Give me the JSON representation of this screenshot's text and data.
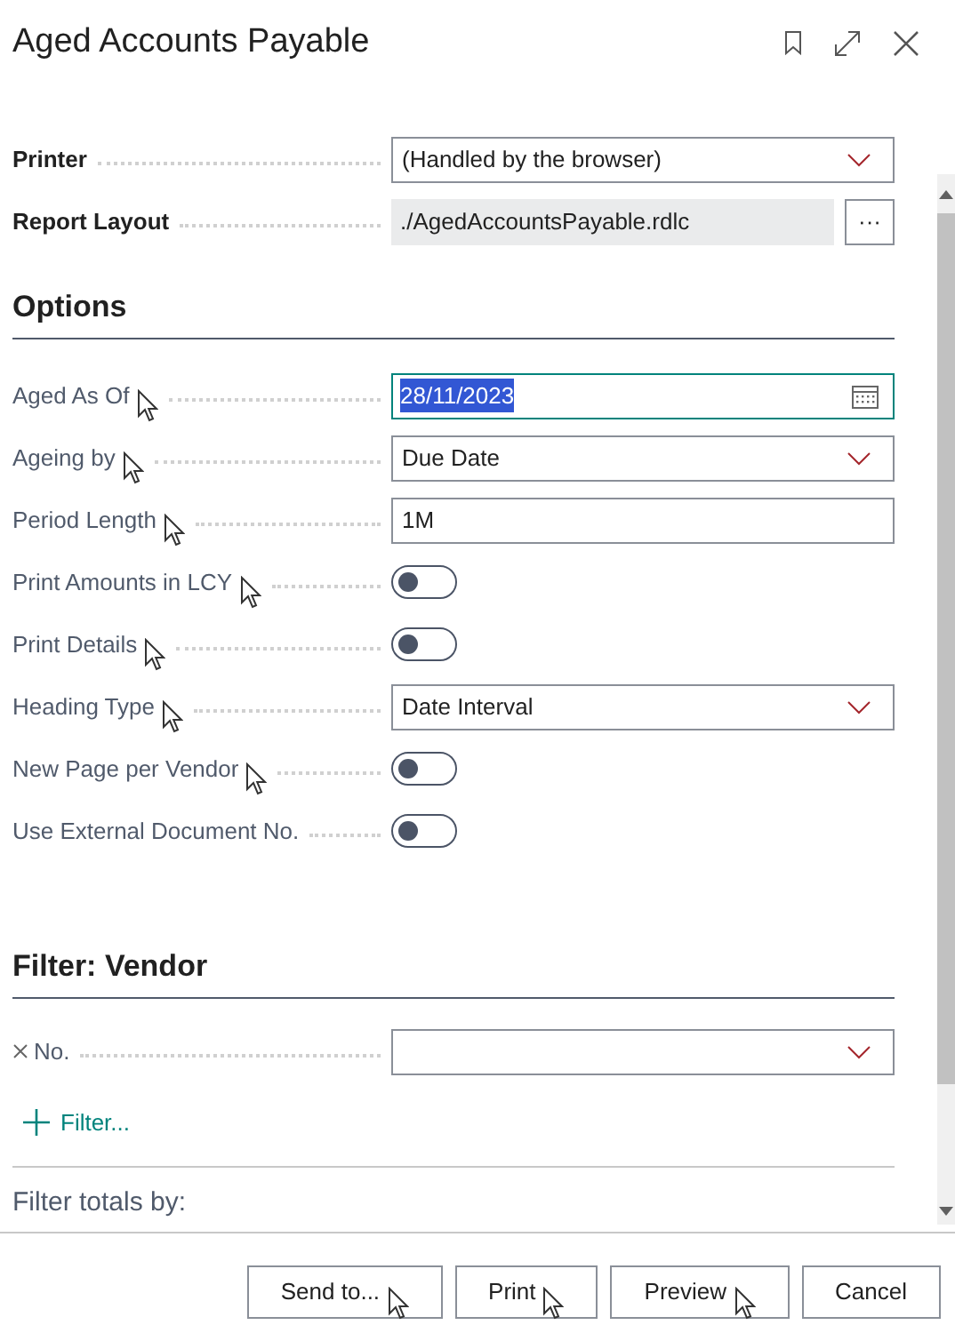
{
  "title": "Aged Accounts Payable",
  "settings": [
    {
      "kind": "dropdown",
      "label": "Printer",
      "value": "(Handled by the browser)",
      "cursor": false
    },
    {
      "kind": "readonly",
      "label": "Report Layout",
      "value": "./AgedAccountsPayable.rdlc",
      "button": "···",
      "cursor": false
    }
  ],
  "options": {
    "heading": "Options",
    "fields": [
      {
        "kind": "date",
        "label": "Aged As Of",
        "value": "28/11/2023",
        "focused": true,
        "cursor": true
      },
      {
        "kind": "dropdown",
        "label": "Ageing by",
        "value": "Due Date",
        "cursor": true
      },
      {
        "kind": "text",
        "label": "Period Length",
        "value": "1M",
        "cursor": true
      },
      {
        "kind": "toggle",
        "label": "Print Amounts in LCY",
        "on": false,
        "cursor": true
      },
      {
        "kind": "toggle",
        "label": "Print Details",
        "on": false,
        "cursor": true
      },
      {
        "kind": "dropdown",
        "label": "Heading Type",
        "value": "Date Interval",
        "cursor": true
      },
      {
        "kind": "toggle",
        "label": "New Page per Vendor",
        "on": false,
        "cursor": true
      },
      {
        "kind": "toggle",
        "label": "Use External Document No.",
        "on": false,
        "cursor": false
      }
    ]
  },
  "filter": {
    "heading": "Filter: Vendor",
    "fields": [
      {
        "kind": "dropdown",
        "label": "No.",
        "cursor": false
      }
    ],
    "add_filter": "Filter...",
    "totals_label": "Filter totals by:"
  },
  "buttons": [
    {
      "label": "Send to...",
      "cursor": true
    },
    {
      "label": "Print",
      "cursor": true
    },
    {
      "label": "Preview",
      "cursor": true
    },
    {
      "label": "Cancel",
      "cursor": false
    }
  ]
}
